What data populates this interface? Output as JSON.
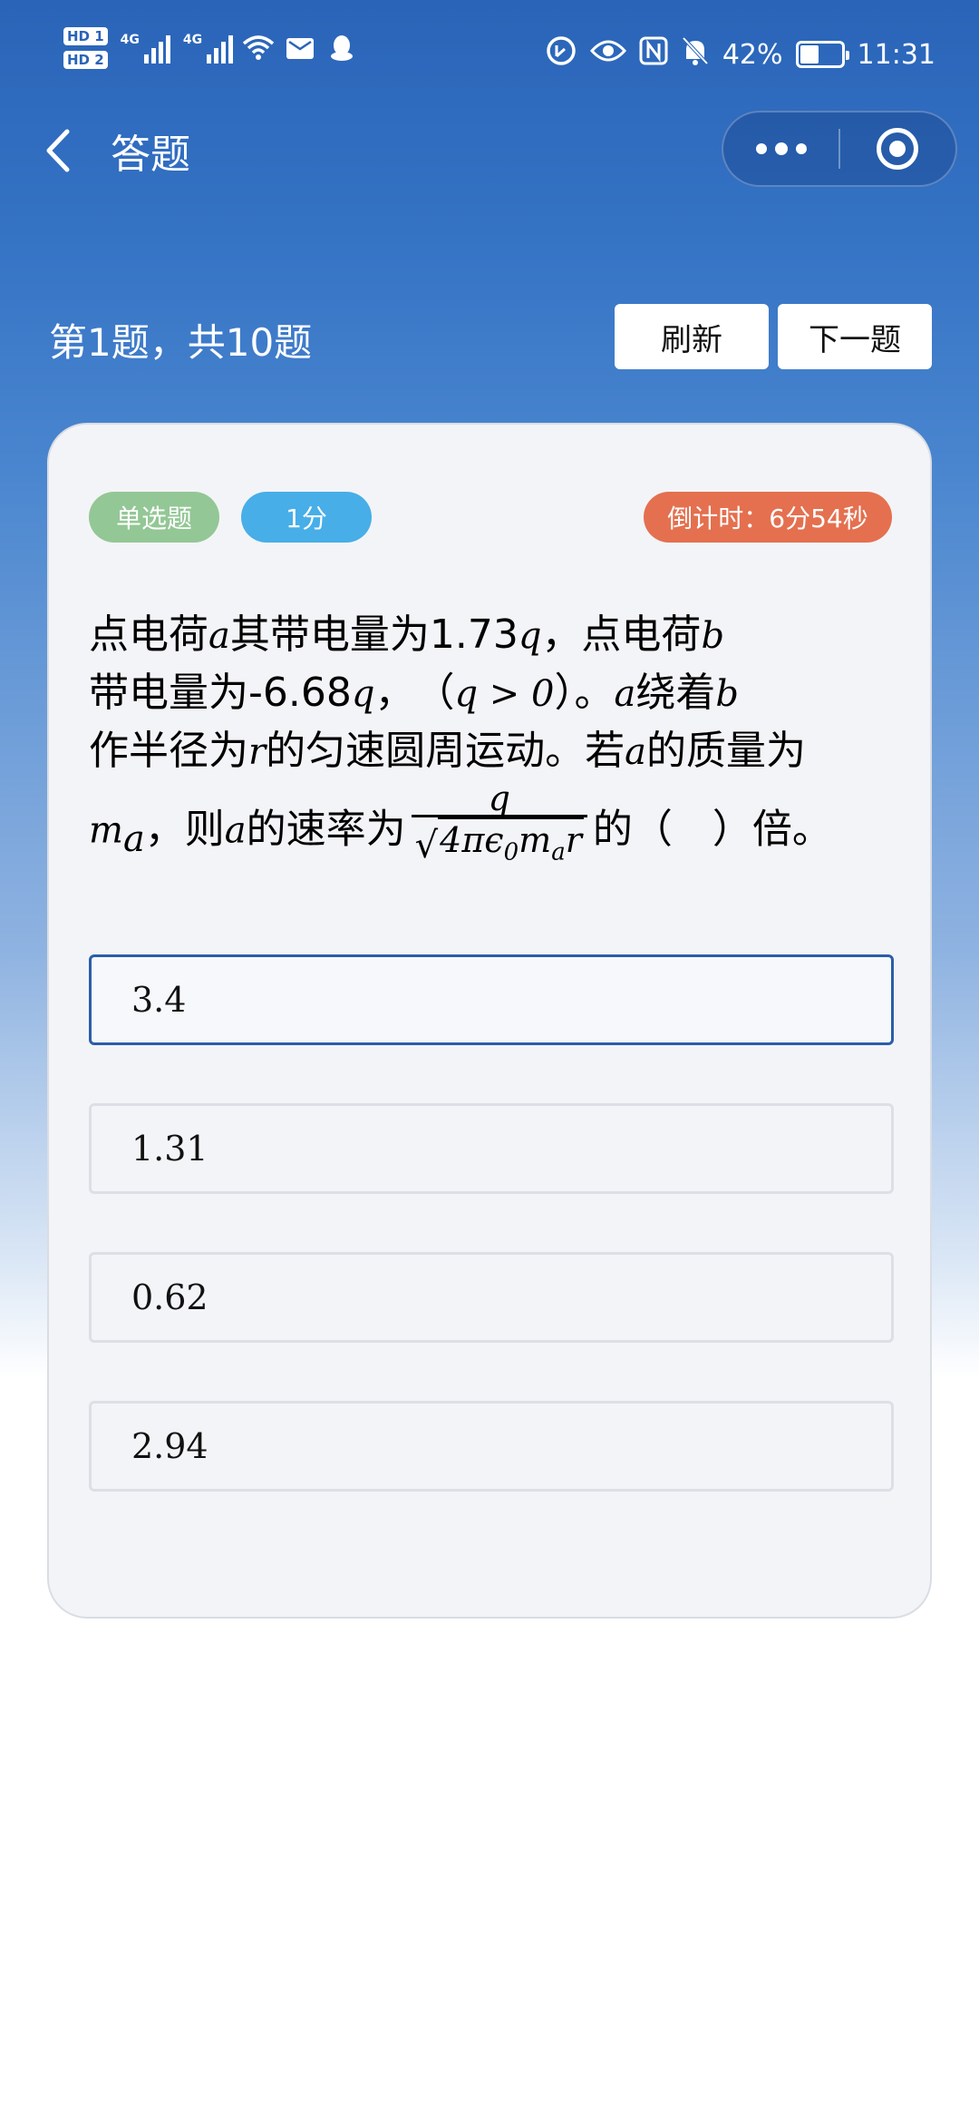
{
  "status_bar": {
    "hd1": "HD 1",
    "hd2": "HD 2",
    "net1": "4G",
    "net2": "4G",
    "battery_percent": "42%",
    "time": "11:31",
    "battery_level": 0.42
  },
  "nav": {
    "title": "答题"
  },
  "quiz": {
    "progress": "第1题，共10题",
    "refresh_label": "刷新",
    "next_label": "下一题"
  },
  "card": {
    "type_tag": "单选题",
    "score_tag": "1分",
    "timer": "倒计时：6分54秒",
    "question": {
      "l1_t1": "点电荷",
      "l1_m1": "a",
      "l1_t2": "其带电量为1.73",
      "l1_m2": "q",
      "l1_t3": "，点电荷",
      "l1_m3": "b",
      "l2_t1": "带电量为-6.68",
      "l2_m1": "q",
      "l2_t2": "，　（",
      "l2_m2": "q > 0",
      "l2_t3": "）。",
      "l2_m3": "a",
      "l2_t4": "绕着",
      "l2_m4": "b",
      "l3_t1": "作半径为",
      "l3_m1": "r",
      "l3_t2": "的匀速圆周运动。若",
      "l3_m2": "a",
      "l3_t3": "的质量为",
      "l4_m1": "m",
      "l4_sub1": "a",
      "l4_t1": "，则",
      "l4_m2": "a",
      "l4_t2": "的速率为",
      "frac_num": "q",
      "frac_den_pre": "4πϵ",
      "frac_den_sub0": "0",
      "frac_den_m": "m",
      "frac_den_sub_a": "a",
      "frac_den_r": "r",
      "l4_t3": "的（　）倍。"
    },
    "options": [
      "3.4",
      "1.31",
      "0.62",
      "2.94"
    ],
    "selected_index": 0
  }
}
